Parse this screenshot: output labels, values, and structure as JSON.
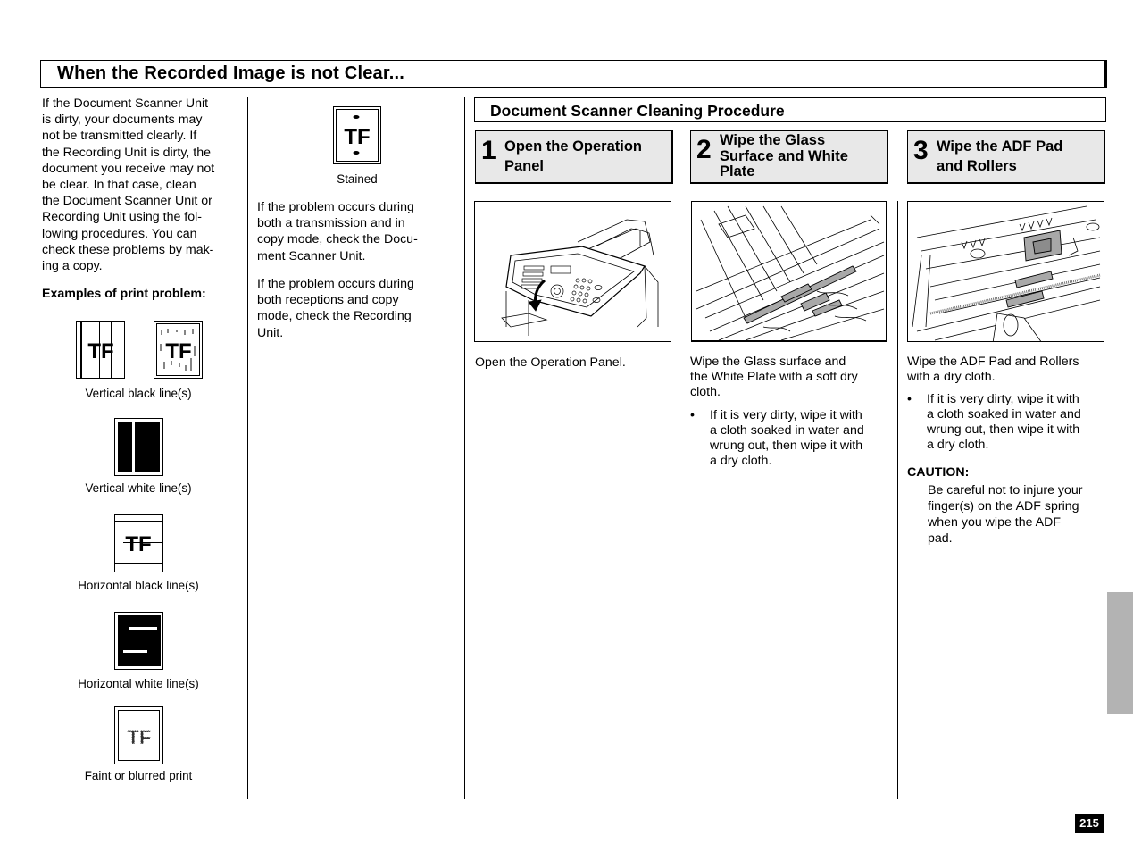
{
  "page": {
    "title": "When the Recorded Image is not Clear...",
    "page_number": "215"
  },
  "intro": {
    "lines": [
      "If the Document Scanner Unit",
      "is dirty, your documents may",
      "not be transmitted clearly. If",
      "the Recording Unit is dirty, the",
      "document you receive may not",
      "be clear.  In that case, clean",
      "the Document Scanner Unit or",
      "Recording Unit using the fol-",
      "lowing procedures. You can",
      "check these problems by mak-",
      "ing a copy."
    ],
    "examples_heading": "Examples of print problem:"
  },
  "examples": [
    {
      "icon": "vertical-black-lines-sample-icon",
      "caption": "Vertical black line(s)",
      "sample_text": "TF"
    },
    {
      "icon": "vertical-white-lines-sample-icon",
      "caption": "Vertical white line(s)"
    },
    {
      "icon": "horizontal-black-lines-sample-icon",
      "caption": "Horizontal black line(s)",
      "sample_text": "TF"
    },
    {
      "icon": "horizontal-white-lines-sample-icon",
      "caption": "Horizontal white line(s)"
    },
    {
      "icon": "faint-print-sample-icon",
      "caption": "Faint or blurred print",
      "sample_text": "TF"
    },
    {
      "icon": "stained-sample-icon",
      "caption": "Stained",
      "sample_text": "TF"
    }
  ],
  "checks": {
    "transmission": [
      "If the problem occurs during",
      "both a transmission and in",
      "copy mode, check the Docu-",
      "ment Scanner Unit."
    ],
    "reception": [
      "If the problem occurs during",
      "both receptions and copy",
      "mode, check the Recording",
      "Unit."
    ]
  },
  "procedure": {
    "title": "Document Scanner Cleaning Procedure",
    "steps": [
      {
        "number": "1",
        "label_lines": [
          "Open the Operation",
          "Panel"
        ],
        "illustration": "open-operation-panel-illustration",
        "description_lines": [
          "Open the Operation Panel."
        ]
      },
      {
        "number": "2",
        "label_lines": [
          "Wipe the Glass",
          "Surface and White",
          "Plate"
        ],
        "illustration": "glass-surface-white-plate-illustration",
        "description_lines": [
          "Wipe the Glass surface and",
          "the White Plate with a soft dry",
          "cloth."
        ],
        "bullet_lines": [
          "If it is very dirty, wipe it with",
          "a cloth soaked in water and",
          "wrung out, then wipe it with",
          "a dry cloth."
        ]
      },
      {
        "number": "3",
        "label_lines": [
          "Wipe the ADF Pad",
          "and Rollers"
        ],
        "illustration": "adf-pad-rollers-illustration",
        "description_lines": [
          "Wipe the ADF Pad and Rollers",
          "with a dry cloth."
        ],
        "bullet_lines": [
          "If it is very dirty, wipe it with",
          "a cloth soaked in water and",
          "wrung out, then wipe it with",
          "a dry cloth."
        ],
        "caution_heading": "CAUTION:",
        "caution_lines": [
          "Be careful not to injure your",
          "finger(s) on the ADF spring",
          "when you wipe the ADF",
          "pad."
        ]
      }
    ]
  },
  "colors": {
    "step_header_bg": "#e8e8e8",
    "tab_marker": "#b3b3b3",
    "highlight_gray": "#a8a8a8"
  }
}
